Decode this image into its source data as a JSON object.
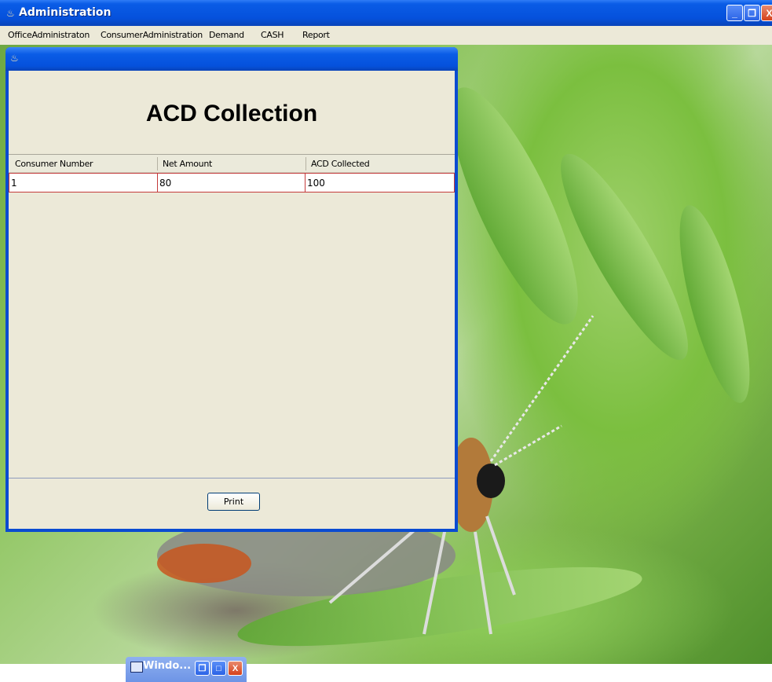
{
  "window": {
    "title": "Administration",
    "controls": {
      "minimize": "_",
      "restore": "❐",
      "close": "X"
    }
  },
  "menu": {
    "items": [
      "OfficeAdministraton",
      "ConsumerAdministration",
      "Demand",
      "CASH",
      "Report"
    ]
  },
  "internal_frame": {
    "heading": "ACD Collection",
    "table": {
      "columns": [
        "Consumer Number",
        "Net Amount",
        "ACD Collected"
      ],
      "rows": [
        [
          "1",
          "80",
          "100"
        ]
      ]
    },
    "print_label": "Print"
  },
  "minimized_window": {
    "label": "Windo...",
    "controls": {
      "restore": "❐",
      "maximize": "□",
      "close": "X"
    }
  },
  "colors": {
    "titlebar": "#0551dc",
    "panel": "#ece9d8",
    "row_border": "#c43b3b",
    "close_red": "#d5411b"
  }
}
